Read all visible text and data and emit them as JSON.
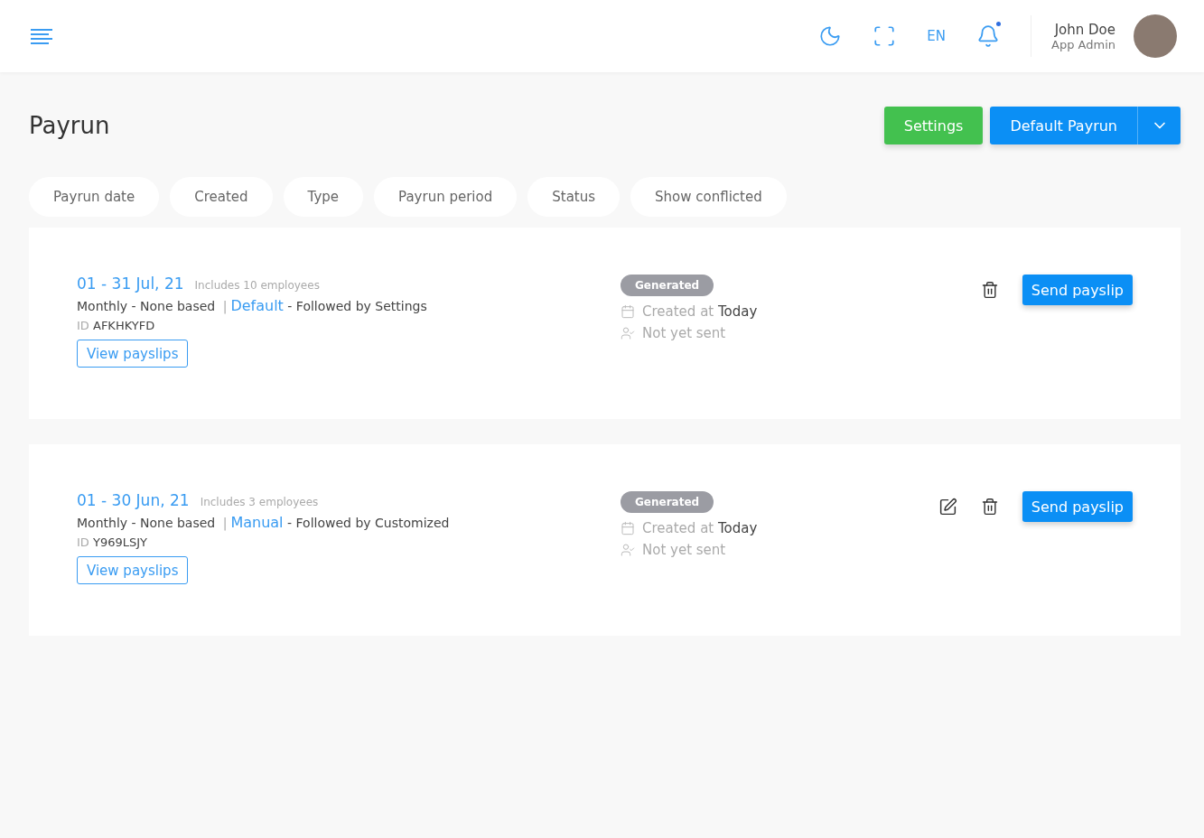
{
  "header": {
    "language": "EN",
    "notification_unread": true,
    "user": {
      "name": "John Doe",
      "role": "App Admin"
    }
  },
  "page": {
    "title": "Payrun",
    "buttons": {
      "settings": "Settings",
      "default_payrun": "Default Payrun"
    }
  },
  "filters": [
    {
      "label": "Payrun date"
    },
    {
      "label": "Created"
    },
    {
      "label": "Type"
    },
    {
      "label": "Payrun period"
    },
    {
      "label": "Status"
    },
    {
      "label": "Show conflicted"
    }
  ],
  "payruns": [
    {
      "period": "01 - 31 Jul, 21",
      "employees": "Includes 10 employees",
      "frequency": "Monthly - None based",
      "separator": "|",
      "mode": "Default",
      "followed": "- Followed by Settings",
      "id_label": "ID",
      "id": "AFKHKYFD",
      "view_button": "View payslips",
      "status": "Generated",
      "created_label": "Created at",
      "created_value": "Today",
      "sent": "Not yet sent",
      "editable": false,
      "send_button": "Send payslip"
    },
    {
      "period": "01 - 30 Jun, 21",
      "employees": "Includes 3 employees",
      "frequency": "Monthly - None based",
      "separator": "|",
      "mode": "Manual",
      "followed": "- Followed by Customized",
      "id_label": "ID",
      "id": "Y969LSJY",
      "view_button": "View payslips",
      "status": "Generated",
      "created_label": "Created at",
      "created_value": "Today",
      "sent": "Not yet sent",
      "editable": true,
      "send_button": "Send payslip"
    }
  ]
}
